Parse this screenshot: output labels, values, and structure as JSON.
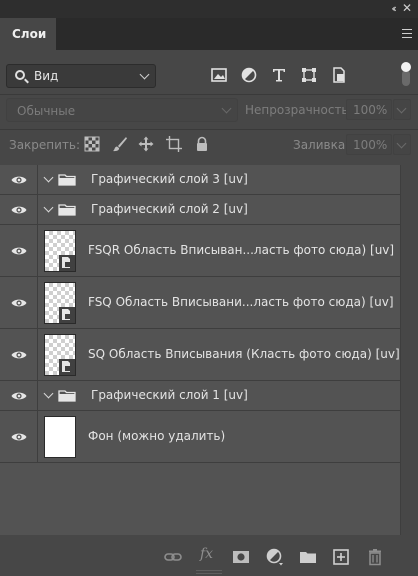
{
  "window": {
    "collapse_glyph": "‹‹",
    "close_glyph": "✕"
  },
  "panel": {
    "tab_label": "Слои",
    "menu_icon": "hamburger-menu-icon"
  },
  "filter": {
    "kind_label": "Вид",
    "icons": [
      "pixel-layer-filter-icon",
      "adjustment-layer-filter-icon",
      "type-layer-filter-icon",
      "shape-layer-filter-icon",
      "smart-object-filter-icon"
    ],
    "toggle_on": true
  },
  "blend": {
    "mode": "Обычные",
    "opacity_label": "Непрозрачность:",
    "opacity_value": "100%"
  },
  "lock": {
    "label": "Закрепить:",
    "icons": [
      "lock-transparent-pixels-icon",
      "lock-image-pixels-icon",
      "lock-position-icon",
      "lock-artboard-icon",
      "lock-all-icon"
    ],
    "fill_label": "Заливка:",
    "fill_value": "100%"
  },
  "layers": [
    {
      "kind": "group",
      "name": "Графический слой 3 [uv]",
      "visible": true
    },
    {
      "kind": "group",
      "name": "Графический слой 2 [uv]",
      "visible": true
    },
    {
      "kind": "smart",
      "name": "FSQR Область Вписыван...ласть фото сюда) [uv]",
      "visible": true
    },
    {
      "kind": "smart",
      "name": "FSQ Область Вписывани...ласть фото сюда) [uv]",
      "visible": true
    },
    {
      "kind": "smart",
      "name": "SQ Область Вписывания (Класть фото сюда) [uv]",
      "visible": true
    },
    {
      "kind": "group",
      "name": "Графический слой 1 [uv]",
      "visible": true
    },
    {
      "kind": "background",
      "name": "Фон (можно удалить)",
      "visible": true
    }
  ],
  "footer": {
    "buttons": [
      "link-layers-icon",
      "fx-icon",
      "add-mask-icon",
      "adjustment-layer-icon",
      "new-group-icon",
      "new-layer-icon",
      "delete-layer-icon"
    ],
    "fx_label": "fx"
  }
}
